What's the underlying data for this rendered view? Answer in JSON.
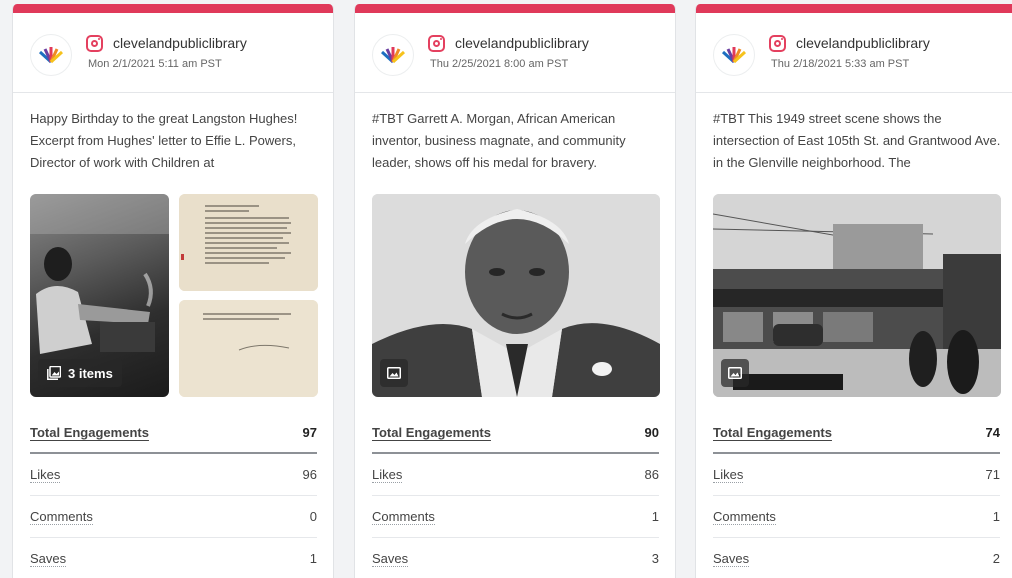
{
  "colors": {
    "accent_bar": "#e0395a",
    "instagram": "#e4405f"
  },
  "cards": [
    {
      "platform_icon": "instagram-icon",
      "handle": "clevelandpubliclibrary",
      "date": "Mon 2/1/2021 5:11 am PST",
      "caption": "Happy Birthday to the great Langston Hughes! Excerpt from Hughes' letter to Effie L. Powers, Director of work with Children at",
      "media_type": "carousel",
      "media_badge": "3 items",
      "stats": {
        "total_label": "Total Engagements",
        "total_value": "97",
        "likes_label": "Likes",
        "likes_value": "96",
        "comments_label": "Comments",
        "comments_value": "0",
        "saves_label": "Saves",
        "saves_value": "1"
      }
    },
    {
      "platform_icon": "instagram-icon",
      "handle": "clevelandpubliclibrary",
      "date": "Thu 2/25/2021 8:00 am PST",
      "caption": "#TBT Garrett A. Morgan, African American inventor, business magnate, and community leader, shows off his medal for bravery.",
      "media_type": "image",
      "stats": {
        "total_label": "Total Engagements",
        "total_value": "90",
        "likes_label": "Likes",
        "likes_value": "86",
        "comments_label": "Comments",
        "comments_value": "1",
        "saves_label": "Saves",
        "saves_value": "3"
      }
    },
    {
      "platform_icon": "instagram-icon",
      "handle": "clevelandpubliclibrary",
      "date": "Thu 2/18/2021 5:33 am PST",
      "caption": "#TBT This 1949 street scene shows the intersection of East 105th St. and Grantwood Ave. in the Glenville neighborhood. The",
      "media_type": "image",
      "stats": {
        "total_label": "Total Engagements",
        "total_value": "74",
        "likes_label": "Likes",
        "likes_value": "71",
        "comments_label": "Comments",
        "comments_value": "1",
        "saves_label": "Saves",
        "saves_value": "2"
      }
    }
  ]
}
